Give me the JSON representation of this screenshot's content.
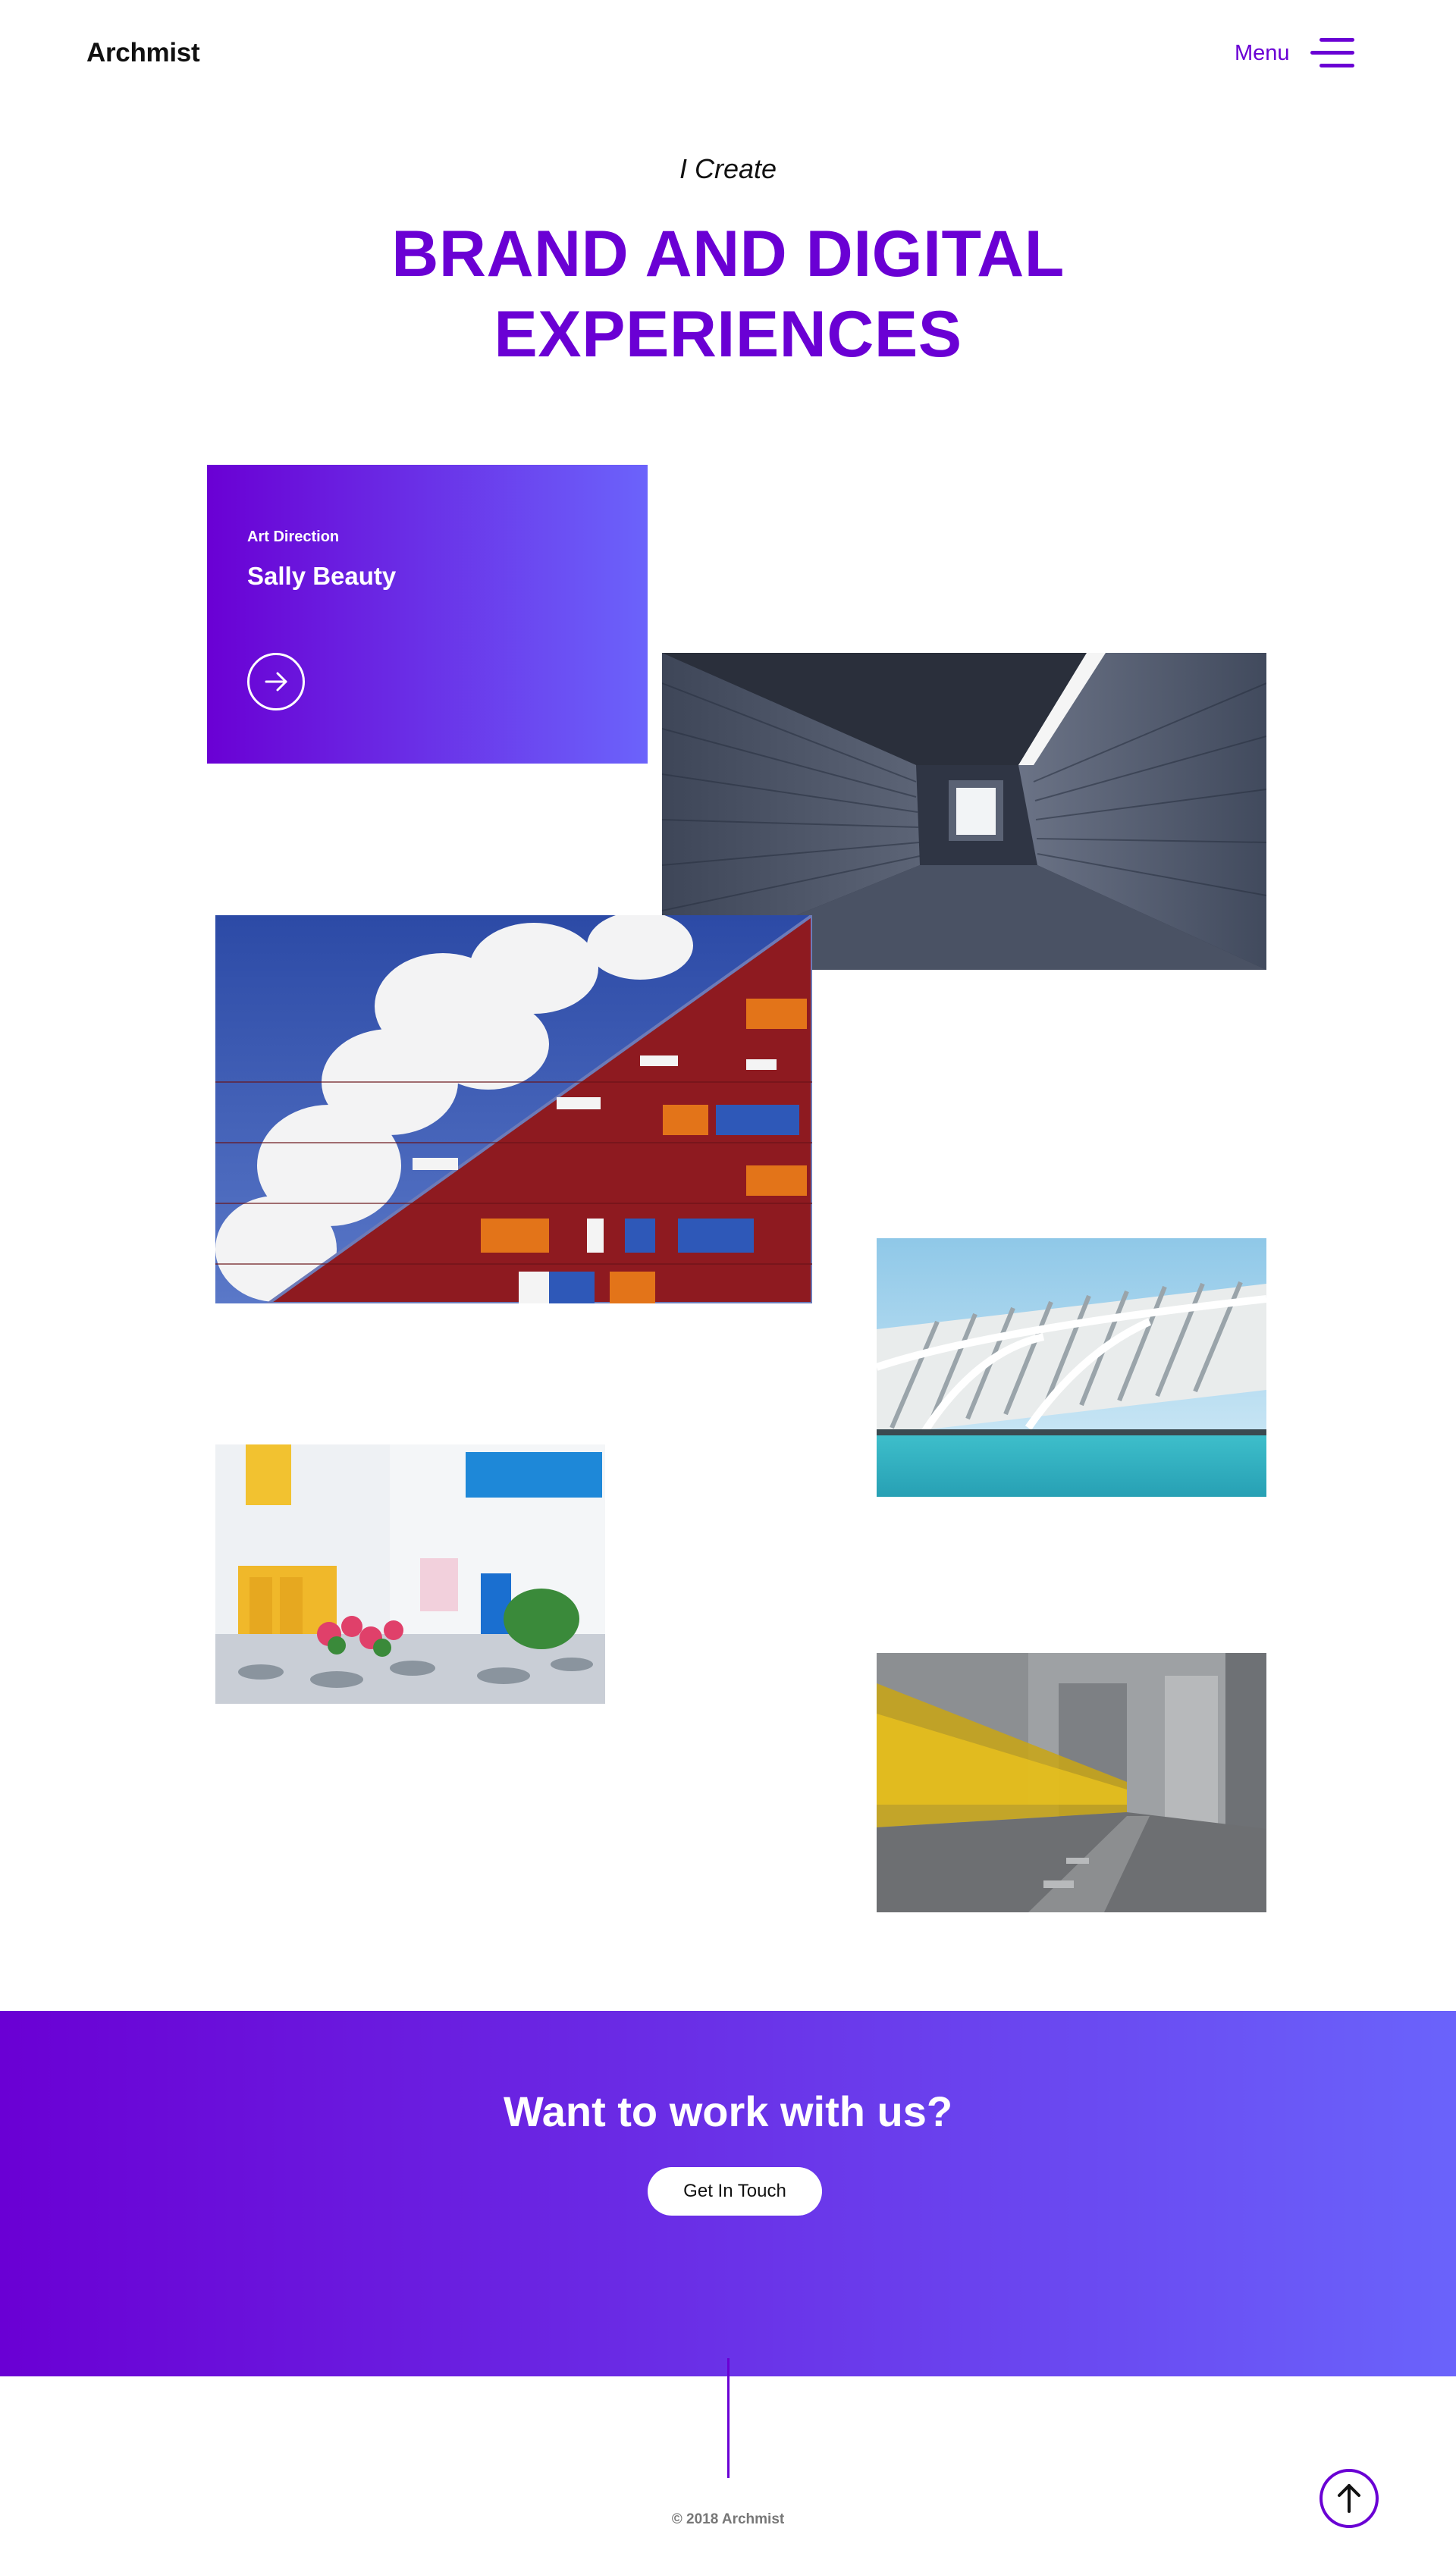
{
  "header": {
    "logo": "Archmist",
    "menu_label": "Menu",
    "menu_icon": "hamburger-icon"
  },
  "hero": {
    "subtitle": "I Create",
    "title_line1": "BRAND AND DIGITAL",
    "title_line2": "EXPERIENCES"
  },
  "feature_card": {
    "tag": "Art Direction",
    "title": "Sally Beauty",
    "arrow_icon": "arrow-right-icon"
  },
  "gallery": [
    {
      "name": "corridor-photo",
      "subject": "perspective corridor of wooden walls"
    },
    {
      "name": "red-building-photo",
      "subject": "red facade building with clouds"
    },
    {
      "name": "calatrava-photo",
      "subject": "white futuristic architecture over water"
    },
    {
      "name": "street-alley-photo",
      "subject": "colorful alley with flowers"
    },
    {
      "name": "tram-photo",
      "subject": "city street with yellow tram motion blur"
    }
  ],
  "cta": {
    "title": "Want to work with us?",
    "button_label": "Get In Touch"
  },
  "footer": {
    "copyright": "© 2018 Archmist",
    "back_to_top_icon": "arrow-up-icon"
  },
  "colors": {
    "brand": "#6a00d4",
    "gradient_end": "#6b63fb"
  }
}
